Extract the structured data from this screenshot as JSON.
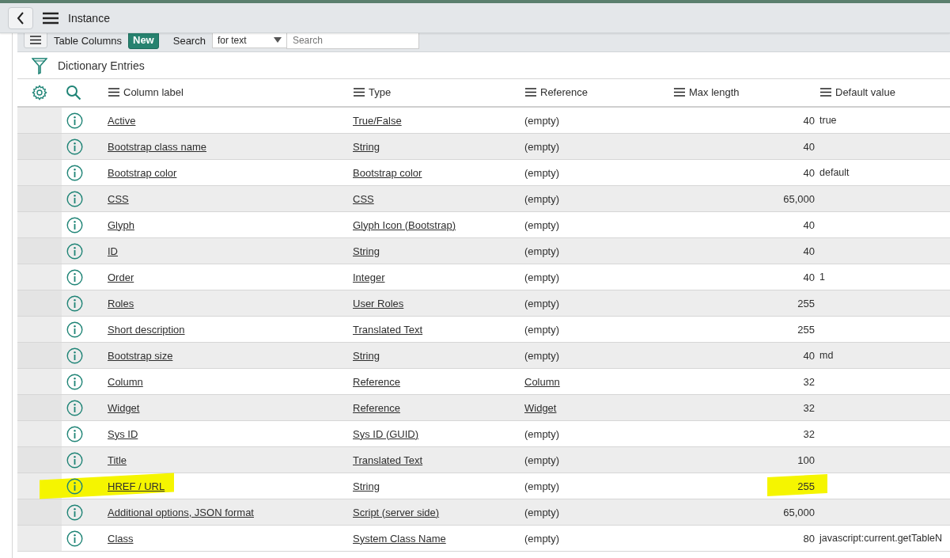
{
  "topbar": {
    "title": "Instance"
  },
  "list_header": {
    "title": "Table Columns",
    "new_button": "New",
    "search_label": "Search",
    "search_field_select": "for text",
    "search_placeholder": "Search"
  },
  "breadcrumb": "Dictionary Entries",
  "table": {
    "columns": [
      "Column label",
      "Type",
      "Reference",
      "Max length",
      "Default value"
    ],
    "rows": [
      {
        "label": "Active",
        "type": "True/False",
        "reference": {
          "text": "(empty)",
          "link": false
        },
        "max_length": "40",
        "default_value": "true",
        "highlighted": false
      },
      {
        "label": "Bootstrap class name",
        "type": "String",
        "reference": {
          "text": "(empty)",
          "link": false
        },
        "max_length": "40",
        "default_value": "",
        "highlighted": false
      },
      {
        "label": "Bootstrap color",
        "type": "Bootstrap color",
        "reference": {
          "text": "(empty)",
          "link": false
        },
        "max_length": "40",
        "default_value": "default",
        "highlighted": false
      },
      {
        "label": "CSS",
        "type": "CSS",
        "reference": {
          "text": "(empty)",
          "link": false
        },
        "max_length": "65,000",
        "default_value": "",
        "highlighted": false
      },
      {
        "label": "Glyph",
        "type": "Glyph Icon (Bootstrap)",
        "reference": {
          "text": "(empty)",
          "link": false
        },
        "max_length": "40",
        "default_value": "",
        "highlighted": false
      },
      {
        "label": "ID",
        "type": "String",
        "reference": {
          "text": "(empty)",
          "link": false
        },
        "max_length": "40",
        "default_value": "",
        "highlighted": false
      },
      {
        "label": "Order",
        "type": "Integer",
        "reference": {
          "text": "(empty)",
          "link": false
        },
        "max_length": "40",
        "default_value": "1",
        "highlighted": false
      },
      {
        "label": "Roles",
        "type": "User Roles",
        "reference": {
          "text": "(empty)",
          "link": false
        },
        "max_length": "255",
        "default_value": "",
        "highlighted": false
      },
      {
        "label": "Short description",
        "type": "Translated Text",
        "reference": {
          "text": "(empty)",
          "link": false
        },
        "max_length": "255",
        "default_value": "",
        "highlighted": false
      },
      {
        "label": "Bootstrap size",
        "type": "String",
        "reference": {
          "text": "(empty)",
          "link": false
        },
        "max_length": "40",
        "default_value": "md",
        "highlighted": false
      },
      {
        "label": "Column",
        "type": "Reference",
        "reference": {
          "text": "Column",
          "link": true
        },
        "max_length": "32",
        "default_value": "",
        "highlighted": false
      },
      {
        "label": "Widget",
        "type": "Reference",
        "reference": {
          "text": "Widget",
          "link": true
        },
        "max_length": "32",
        "default_value": "",
        "highlighted": false
      },
      {
        "label": "Sys ID",
        "type": "Sys ID (GUID)",
        "reference": {
          "text": "(empty)",
          "link": false
        },
        "max_length": "32",
        "default_value": "",
        "highlighted": false
      },
      {
        "label": "Title",
        "type": "Translated Text",
        "reference": {
          "text": "(empty)",
          "link": false
        },
        "max_length": "100",
        "default_value": "",
        "highlighted": false
      },
      {
        "label": "HREF / URL",
        "type": "String",
        "reference": {
          "text": "(empty)",
          "link": false
        },
        "max_length": "255",
        "default_value": "",
        "highlighted": true
      },
      {
        "label": "Additional options, JSON format",
        "type": "Script (server side)",
        "reference": {
          "text": "(empty)",
          "link": false
        },
        "max_length": "65,000",
        "default_value": "",
        "highlighted": false
      },
      {
        "label": "Class",
        "type": "System Class Name",
        "reference": {
          "text": "(empty)",
          "link": false
        },
        "max_length": "80",
        "default_value": "javascript:current.getTableN",
        "highlighted": false
      }
    ]
  }
}
